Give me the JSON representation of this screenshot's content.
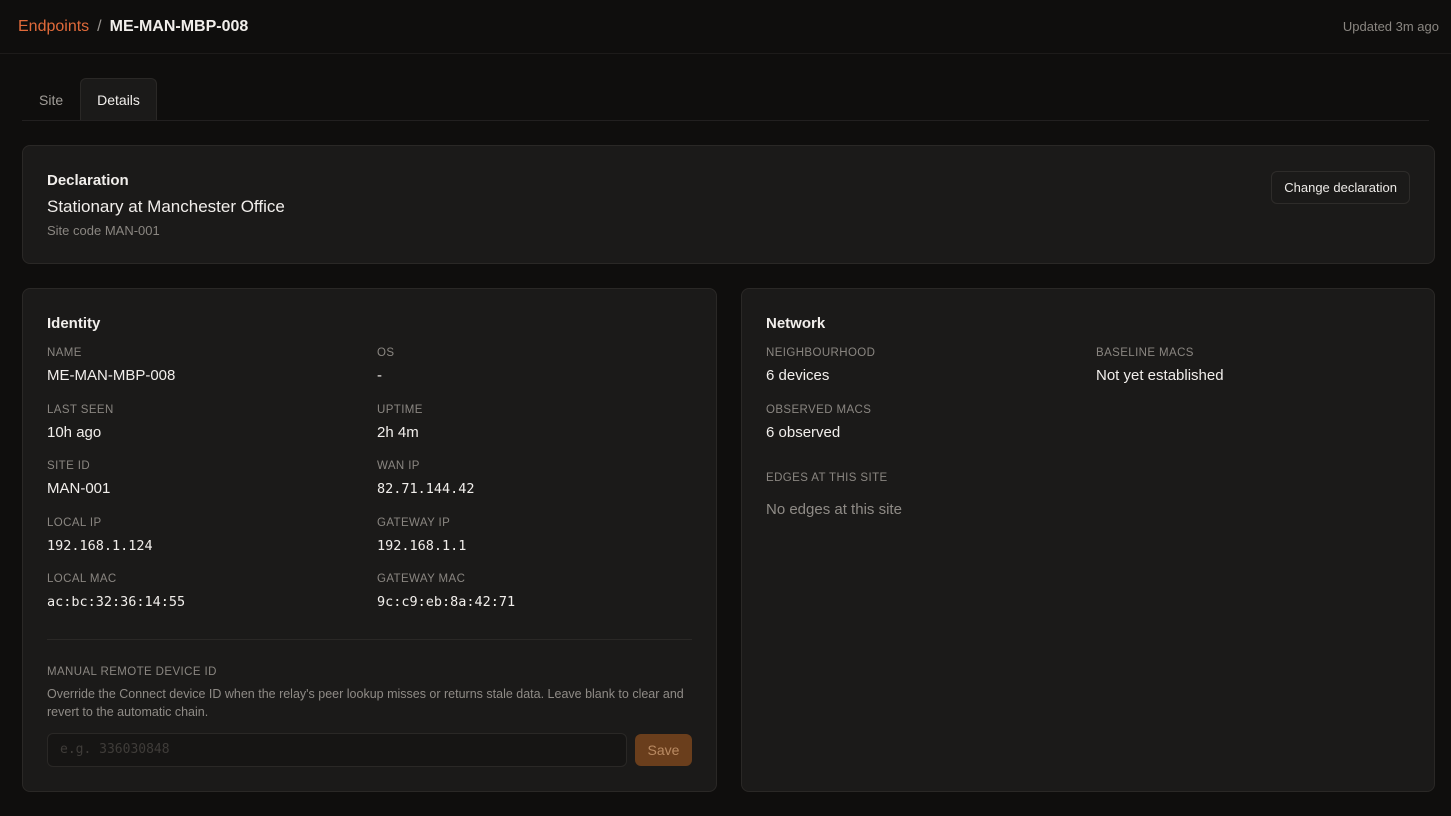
{
  "breadcrumb": {
    "parent": "Endpoints",
    "separator": "/",
    "current": "ME-MAN-MBP-008"
  },
  "updated": "Updated 3m ago",
  "tabs": [
    {
      "label": "Site"
    },
    {
      "label": "Details",
      "active": true
    }
  ],
  "declaration": {
    "title": "Declaration",
    "value": "Stationary at Manchester Office",
    "sub": "Site code MAN-001",
    "button": "Change declaration"
  },
  "identity": {
    "title": "Identity",
    "fields": [
      {
        "label": "NAME",
        "value": "ME-MAN-MBP-008"
      },
      {
        "label": "OS",
        "value": "-"
      },
      {
        "label": "LAST SEEN",
        "value": "10h ago"
      },
      {
        "label": "UPTIME",
        "value": "2h 4m"
      },
      {
        "label": "SITE ID",
        "value": "MAN-001"
      },
      {
        "label": "WAN IP",
        "value": "82.71.144.42"
      },
      {
        "label": "LOCAL IP",
        "value": "192.168.1.124"
      },
      {
        "label": "GATEWAY IP",
        "value": "192.168.1.1"
      },
      {
        "label": "LOCAL MAC",
        "value": "ac:bc:32:36:14:55"
      },
      {
        "label": "GATEWAY MAC",
        "value": "9c:c9:eb:8a:42:71"
      }
    ],
    "manual": {
      "label": "MANUAL REMOTE DEVICE ID",
      "description": "Override the Connect device ID when the relay's peer lookup misses or returns stale data. Leave blank to clear and revert to the automatic chain.",
      "placeholder": "e.g. 336030848",
      "save": "Save"
    }
  },
  "network": {
    "title": "Network",
    "fields": [
      {
        "label": "NEIGHBOURHOOD",
        "value": "6 devices"
      },
      {
        "label": "BASELINE MACS",
        "value": "Not yet established"
      },
      {
        "label": "OBSERVED MACS",
        "value": "6 observed"
      }
    ],
    "edges_label": "EDGES AT THIS SITE",
    "edges_empty": "No edges at this site"
  },
  "colors": {
    "accent": "#e06a3a",
    "background": "#0f0e0d",
    "card": "#1b1a19",
    "save_button": "#6a3e1c"
  }
}
